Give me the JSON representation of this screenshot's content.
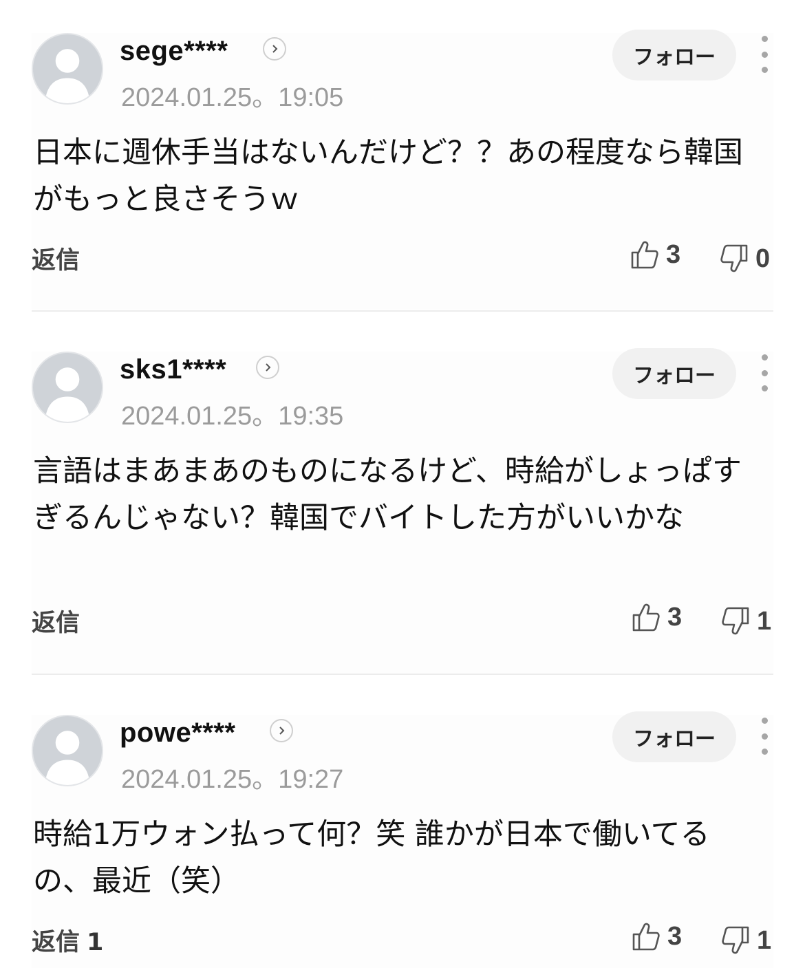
{
  "comments": [
    {
      "username": "sege****",
      "timestamp": "2024.01.25。19:05",
      "follow_label": "フォロー",
      "text": "日本に週休手当はないんだけど？？あの程度なら韓国がもっと良さそうｗ",
      "reply_label": "返信",
      "reply_count": "",
      "likes": "3",
      "dislikes": "0"
    },
    {
      "username": "sks1****",
      "timestamp": "2024.01.25。19:35",
      "follow_label": "フォロー",
      "text": "言語はまあまあのものになるけど、時給がしょっぱすぎるんじゃない？韓国でバイトした方がいいかな",
      "reply_label": "返信",
      "reply_count": "",
      "likes": "3",
      "dislikes": "1"
    },
    {
      "username": "powe****",
      "timestamp": "2024.01.25。19:27",
      "follow_label": "フォロー",
      "text": "時給1万ウォン払って何？笑 誰かが日本で働いてるの、最近（笑）",
      "reply_label": "返信",
      "reply_count": "1",
      "likes": "3",
      "dislikes": "1"
    }
  ],
  "icons": {
    "avatar": "user-silhouette-icon",
    "profile_link": "chevron-right-icon",
    "menu": "more-vertical-icon",
    "like": "thumbs-up-icon",
    "dislike": "thumbs-down-icon"
  }
}
